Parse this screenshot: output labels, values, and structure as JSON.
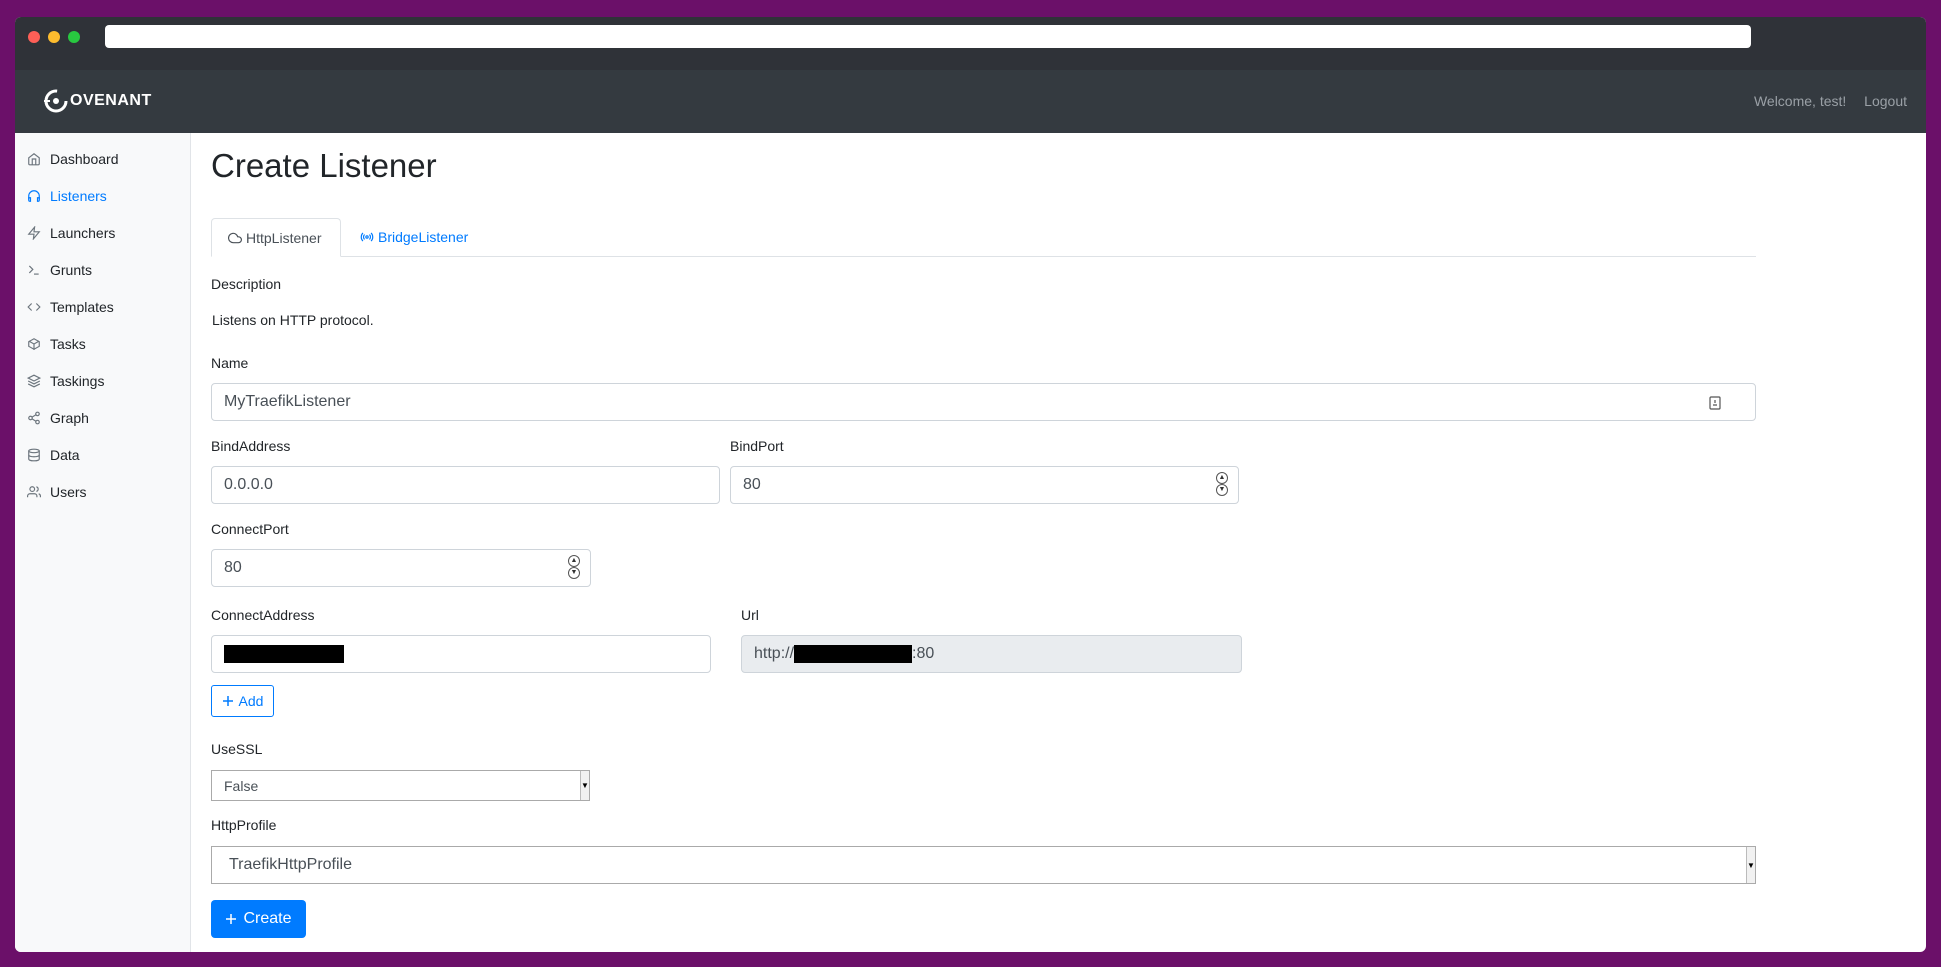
{
  "browser": {
    "url": ""
  },
  "navbar": {
    "brand": "OVENANT",
    "welcome": "Welcome, test!",
    "logout": "Logout"
  },
  "sidebar": {
    "items": [
      {
        "label": "Dashboard",
        "icon": "home-icon"
      },
      {
        "label": "Listeners",
        "icon": "headphones-icon",
        "active": true
      },
      {
        "label": "Launchers",
        "icon": "zap-icon"
      },
      {
        "label": "Grunts",
        "icon": "terminal-icon"
      },
      {
        "label": "Templates",
        "icon": "code-icon"
      },
      {
        "label": "Tasks",
        "icon": "box-icon"
      },
      {
        "label": "Taskings",
        "icon": "layers-icon"
      },
      {
        "label": "Graph",
        "icon": "share-icon"
      },
      {
        "label": "Data",
        "icon": "database-icon"
      },
      {
        "label": "Users",
        "icon": "users-icon"
      }
    ]
  },
  "page": {
    "title": "Create Listener",
    "tabs": [
      {
        "label": "HttpListener",
        "icon": "cloud-icon",
        "active": true
      },
      {
        "label": "BridgeListener",
        "icon": "broadcast-icon",
        "active": false
      }
    ]
  },
  "form": {
    "description_label": "Description",
    "description_text": "Listens on HTTP protocol.",
    "name_label": "Name",
    "name_value": "MyTraefikListener",
    "bind_address_label": "BindAddress",
    "bind_address_value": "0.0.0.0",
    "bind_port_label": "BindPort",
    "bind_port_value": "80",
    "connect_port_label": "ConnectPort",
    "connect_port_value": "80",
    "connect_address_label": "ConnectAddress",
    "url_label": "Url",
    "url_prefix": "http://",
    "url_suffix": ":80",
    "add_label": "Add",
    "use_ssl_label": "UseSSL",
    "use_ssl_value": "False",
    "http_profile_label": "HttpProfile",
    "http_profile_value": "TraefikHttpProfile",
    "create_label": "Create"
  },
  "colors": {
    "primary": "#007bff",
    "navbar": "#343a40",
    "background": "#6b1069"
  }
}
